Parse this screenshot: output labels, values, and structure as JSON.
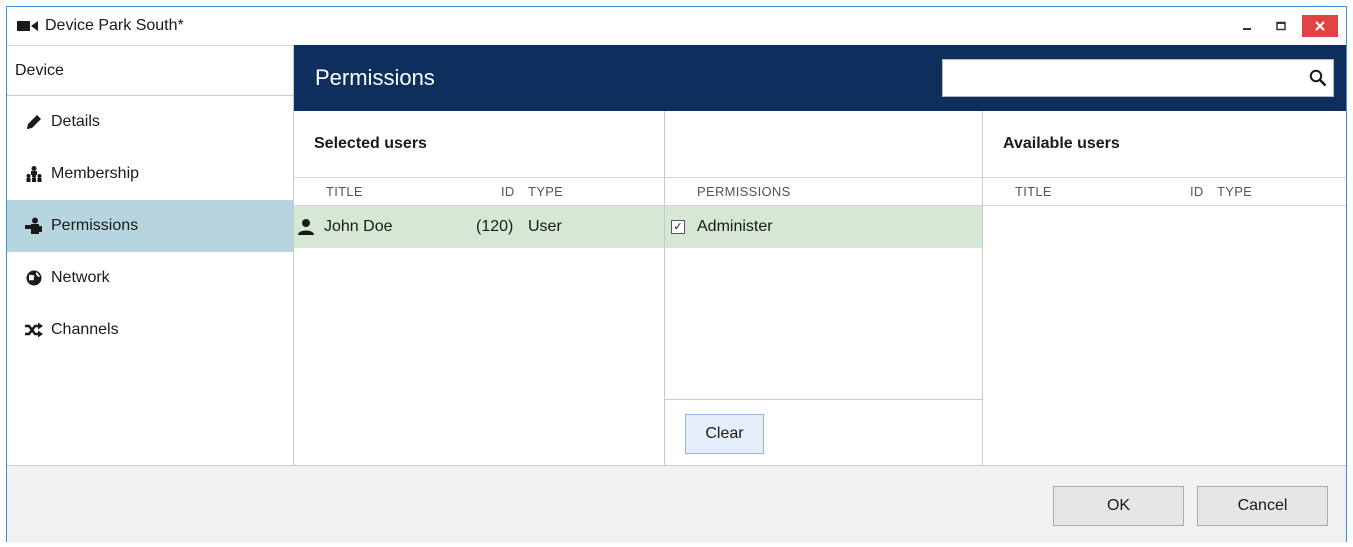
{
  "window": {
    "title": "Device Park South*",
    "controls": {
      "minimize": "–",
      "maximize": "□",
      "close": "✕"
    }
  },
  "sidebar": {
    "header": "Device",
    "items": [
      {
        "label": "Details",
        "icon": "pencil-icon",
        "active": false
      },
      {
        "label": "Membership",
        "icon": "membership-icon",
        "active": false
      },
      {
        "label": "Permissions",
        "icon": "permissions-icon",
        "active": true
      },
      {
        "label": "Network",
        "icon": "globe-icon",
        "active": false
      },
      {
        "label": "Channels",
        "icon": "shuffle-icon",
        "active": false
      }
    ]
  },
  "main": {
    "title": "Permissions",
    "search": {
      "value": "",
      "placeholder": ""
    },
    "selected_users": {
      "title": "Selected users",
      "columns": [
        "TITLE",
        "ID",
        "TYPE"
      ],
      "rows": [
        {
          "title": "John Doe",
          "id": "(120)",
          "type": "User"
        }
      ]
    },
    "permissions": {
      "column": "PERMISSIONS",
      "items": [
        {
          "label": "Administer",
          "checked": true
        }
      ],
      "clear_label": "Clear"
    },
    "available_users": {
      "title": "Available users",
      "columns": [
        "TITLE",
        "ID",
        "TYPE"
      ],
      "rows": []
    }
  },
  "footer": {
    "ok_label": "OK",
    "cancel_label": "Cancel"
  },
  "colors": {
    "header_bg": "#0e2f5e",
    "active_nav": "#b7d5de",
    "selected_row": "#d4e8d4",
    "close_btn": "#e04343"
  }
}
